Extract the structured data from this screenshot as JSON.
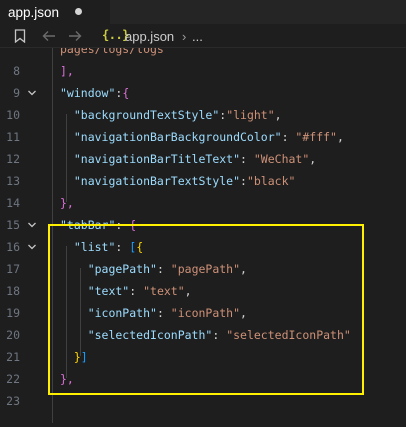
{
  "tab": {
    "title": "app.json"
  },
  "breadcrumb": {
    "icon_text": "{..}",
    "file": "app.json",
    "separator": "›",
    "more": "..."
  },
  "lines": [
    {
      "num": "",
      "tokens": [
        {
          "t": "pages/logs/logs",
          "c": "s"
        }
      ],
      "fold": false,
      "partial": true
    },
    {
      "num": "8",
      "tokens": [
        {
          "t": "],",
          "c": "b2"
        }
      ],
      "fold": false
    },
    {
      "num": "9",
      "tokens": [
        {
          "t": "\"window\"",
          "c": "k"
        },
        {
          "t": ":",
          "c": "p"
        },
        {
          "t": "{",
          "c": "b2"
        }
      ],
      "fold": true
    },
    {
      "num": "10",
      "tokens": [
        {
          "t": "  \"backgroundTextStyle\"",
          "c": "k"
        },
        {
          "t": ":",
          "c": "p"
        },
        {
          "t": "\"light\"",
          "c": "s"
        },
        {
          "t": ",",
          "c": "p"
        }
      ],
      "fold": false
    },
    {
      "num": "11",
      "tokens": [
        {
          "t": "  \"navigationBarBackgroundColor\"",
          "c": "k"
        },
        {
          "t": ": ",
          "c": "p"
        },
        {
          "t": "\"#fff\"",
          "c": "s"
        },
        {
          "t": ",",
          "c": "p"
        }
      ],
      "fold": false
    },
    {
      "num": "12",
      "tokens": [
        {
          "t": "  \"navigationBarTitleText\"",
          "c": "k"
        },
        {
          "t": ": ",
          "c": "p"
        },
        {
          "t": "\"WeChat\"",
          "c": "s"
        },
        {
          "t": ",",
          "c": "p"
        }
      ],
      "fold": false
    },
    {
      "num": "13",
      "tokens": [
        {
          "t": "  \"navigationBarTextStyle\"",
          "c": "k"
        },
        {
          "t": ":",
          "c": "p"
        },
        {
          "t": "\"black\"",
          "c": "s"
        }
      ],
      "fold": false
    },
    {
      "num": "14",
      "tokens": [
        {
          "t": "},",
          "c": "b2"
        }
      ],
      "fold": false
    },
    {
      "num": "15",
      "tokens": [
        {
          "t": "\"tabBar\"",
          "c": "k"
        },
        {
          "t": ": ",
          "c": "p"
        },
        {
          "t": "{",
          "c": "b2"
        }
      ],
      "fold": true
    },
    {
      "num": "16",
      "tokens": [
        {
          "t": "  \"list\"",
          "c": "k"
        },
        {
          "t": ": ",
          "c": "p"
        },
        {
          "t": "[",
          "c": "b3"
        },
        {
          "t": "{",
          "c": "b1"
        }
      ],
      "fold": true
    },
    {
      "num": "17",
      "tokens": [
        {
          "t": "    \"pagePath\"",
          "c": "k"
        },
        {
          "t": ": ",
          "c": "p"
        },
        {
          "t": "\"pagePath\"",
          "c": "s"
        },
        {
          "t": ",",
          "c": "p"
        }
      ],
      "fold": false
    },
    {
      "num": "18",
      "tokens": [
        {
          "t": "    \"text\"",
          "c": "k"
        },
        {
          "t": ": ",
          "c": "p"
        },
        {
          "t": "\"text\"",
          "c": "s"
        },
        {
          "t": ",",
          "c": "p"
        }
      ],
      "fold": false
    },
    {
      "num": "19",
      "tokens": [
        {
          "t": "    \"iconPath\"",
          "c": "k"
        },
        {
          "t": ": ",
          "c": "p"
        },
        {
          "t": "\"iconPath\"",
          "c": "s"
        },
        {
          "t": ",",
          "c": "p"
        }
      ],
      "fold": false
    },
    {
      "num": "20",
      "tokens": [
        {
          "t": "    \"selectedIconPath\"",
          "c": "k"
        },
        {
          "t": ": ",
          "c": "p"
        },
        {
          "t": "\"selectedIconPath\"",
          "c": "s"
        }
      ],
      "fold": false
    },
    {
      "num": "21",
      "tokens": [
        {
          "t": "  }",
          "c": "b1"
        },
        {
          "t": "]",
          "c": "b3"
        }
      ],
      "fold": false
    },
    {
      "num": "22",
      "tokens": [
        {
          "t": "},",
          "c": "b2"
        }
      ],
      "fold": false
    },
    {
      "num": "23",
      "tokens": [],
      "fold": false
    }
  ],
  "colors": {
    "editor_bg": "#1e1e1e",
    "key": "#9cdcfe",
    "string": "#ce9178",
    "bracket_gold": "#ffd700",
    "bracket_orchid": "#da70d6",
    "bracket_blue": "#179fff",
    "annotation_box": "#ffef00"
  }
}
